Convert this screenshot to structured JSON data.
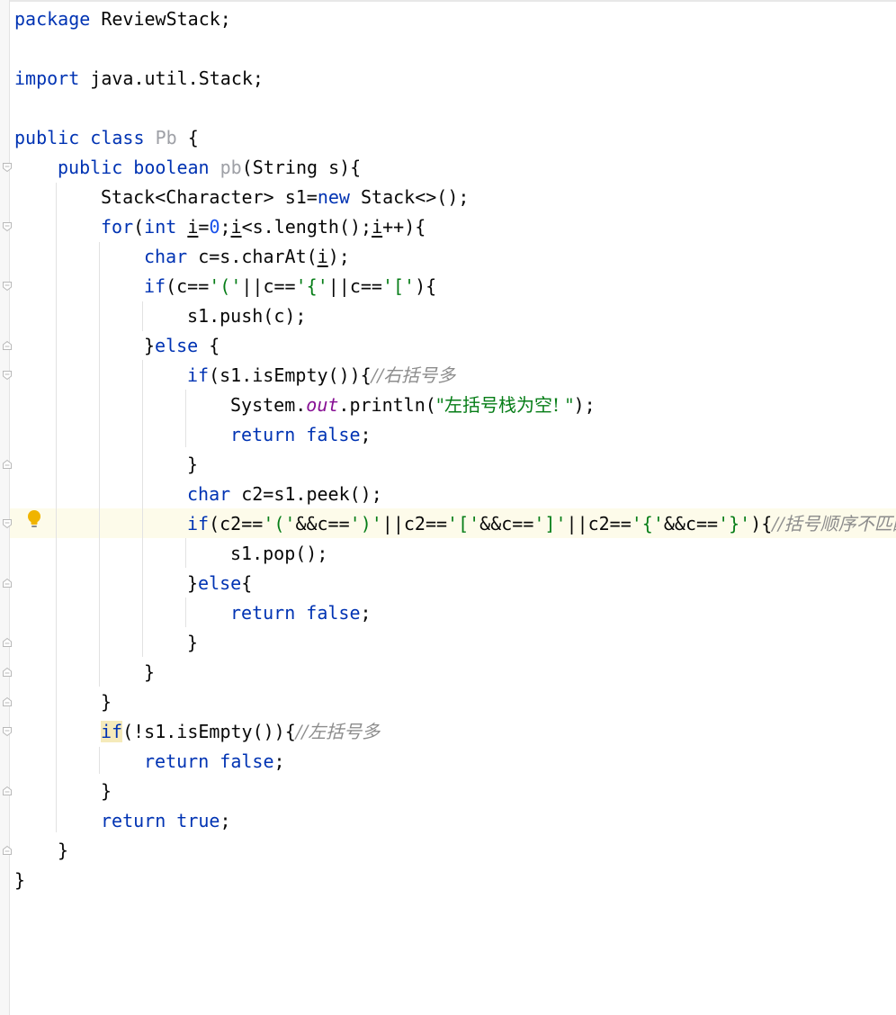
{
  "code": {
    "l1": [
      "package",
      " ReviewStack;"
    ],
    "l3": [
      "import",
      " java.util.Stack;"
    ],
    "l5": [
      "public",
      " ",
      "class",
      " ",
      "Pb",
      " {"
    ],
    "l6": [
      "public",
      " ",
      "boolean",
      " ",
      "pb",
      "(String s){"
    ],
    "l7": [
      "Stack<Character> s1=",
      "new",
      " Stack<>();"
    ],
    "l8": [
      "for",
      "(",
      "int",
      " ",
      "i",
      "=",
      "0",
      ";",
      "i",
      "<s.length();",
      "i",
      "++){"
    ],
    "l9": [
      "char",
      " c=s.charAt(",
      "i",
      ");"
    ],
    "l10": [
      "if",
      "(c==",
      "'('",
      "||c==",
      "'{'",
      "||c==",
      "'['",
      "){"
    ],
    "l11": [
      "s1.push(c);"
    ],
    "l12": [
      "}",
      "else",
      " {"
    ],
    "l13": [
      "if",
      "(s1.isEmpty()){",
      "//右括号多"
    ],
    "l14": [
      "System.",
      "out",
      ".println(",
      "\"左括号栈为空! \"",
      ");"
    ],
    "l15": [
      "return",
      " ",
      "false",
      ";"
    ],
    "l16": [
      "}"
    ],
    "l17": [
      "char",
      " c2=s1.peek();"
    ],
    "l18": [
      "if",
      "(c2==",
      "'('",
      "&&c==",
      "')'",
      "||c2==",
      "'['",
      "&&c==",
      "']'",
      "||c2==",
      "'{'",
      "&&c==",
      "'}'",
      "){",
      "//括号顺序不匹配"
    ],
    "l19": [
      "s1.pop();"
    ],
    "l20": [
      "}",
      "else",
      "{"
    ],
    "l21": [
      "return",
      " ",
      "false",
      ";"
    ],
    "l22": [
      "}"
    ],
    "l23": [
      "}"
    ],
    "l24": [
      "}"
    ],
    "l25": [
      "if",
      "(!s1.isEmpty()){",
      "//左括号多"
    ],
    "l26": [
      "return",
      " ",
      "false",
      ";"
    ],
    "l27": [
      "}"
    ],
    "l28": [
      "return",
      " ",
      "true",
      ";"
    ],
    "l29": [
      "}"
    ],
    "l30": [
      "}"
    ]
  },
  "icons": {
    "intention": "lightbulb-icon",
    "fold": "fold-marker-icon"
  },
  "colors": {
    "keyword": "#0033b3",
    "number": "#1750eb",
    "string": "#067d17",
    "comment": "#8c8c8c",
    "static_field": "#871094",
    "unused": "#9ea0a6",
    "current_line": "#fdfbea",
    "brace_match": "#f5eaba",
    "bulb": "#f0b400"
  }
}
